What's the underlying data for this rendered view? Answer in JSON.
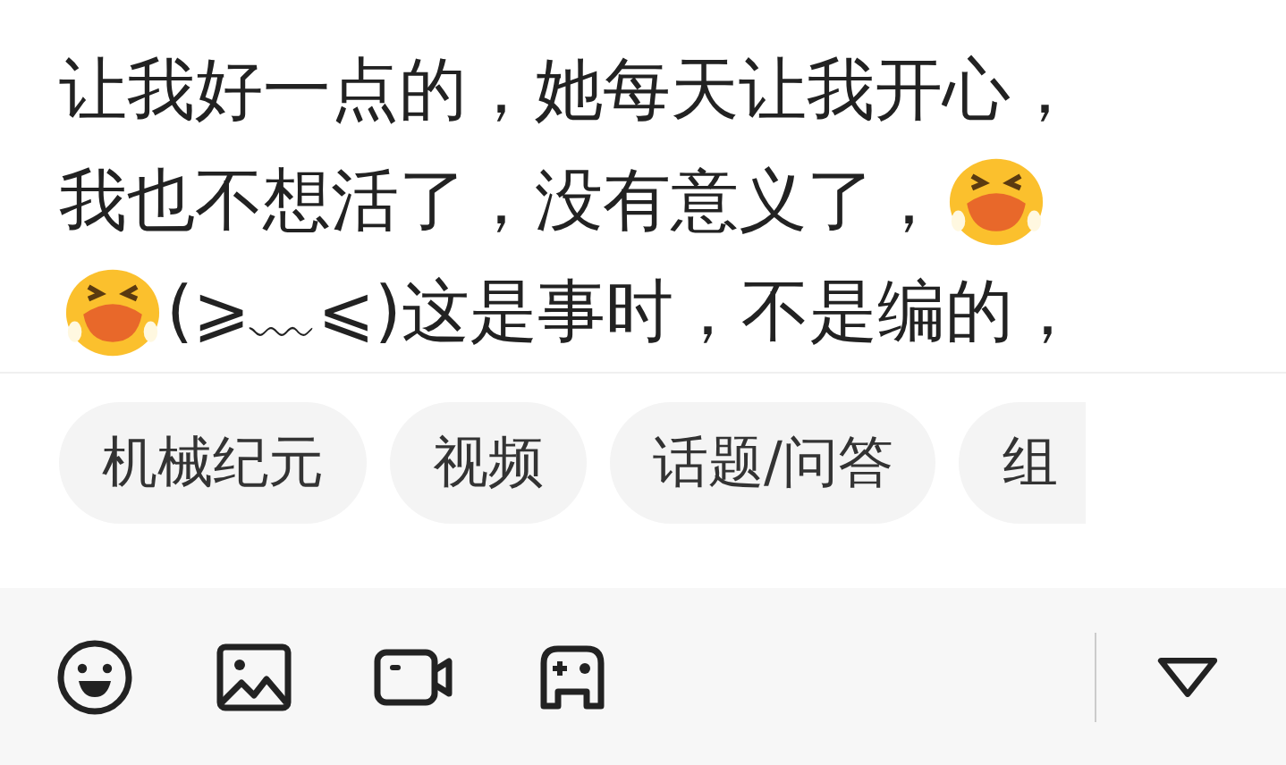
{
  "post_text": {
    "lines": [
      [
        {
          "kind": "text",
          "text": "让我好一点的，她每天让我开心，"
        }
      ],
      [
        {
          "kind": "text",
          "text": "我也不想活了，没有意义了，"
        },
        {
          "kind": "emoji"
        }
      ],
      [
        {
          "kind": "emoji"
        },
        {
          "kind": "text",
          "text": "(⩾﹏⩽)这是事时，不是编的，"
        }
      ]
    ]
  },
  "topic_tags": [
    "机械纪元",
    "视频",
    "话题/问答",
    "组"
  ],
  "toolbar": {
    "tools": [
      {
        "kind": "emoji"
      },
      {
        "kind": "image"
      },
      {
        "kind": "video"
      },
      {
        "kind": "game"
      }
    ],
    "collapse": {
      "kind": "triangle"
    }
  }
}
